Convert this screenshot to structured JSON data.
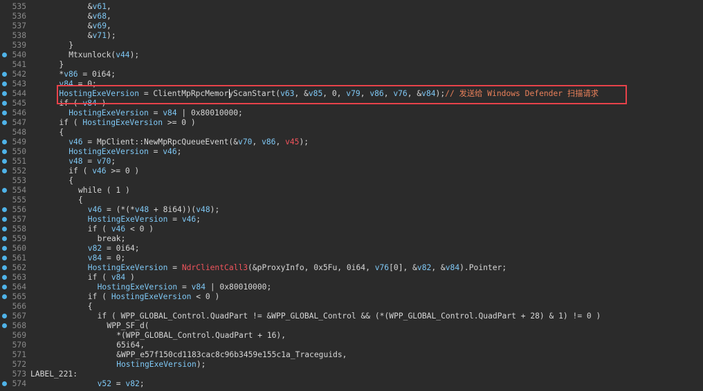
{
  "colors": {
    "background": "#2b2b2b",
    "default_text": "#d7d7d7",
    "variable": "#7fc8f5",
    "keyword_highlight": "#f0545c",
    "comment": "#e9805a",
    "breakpoint_dot": "#4fb3e8",
    "highlight_box": "#e8424a"
  },
  "lines": [
    {
      "n": "535",
      "bp": false,
      "indent": 6,
      "t": [
        [
          "w",
          "&"
        ],
        [
          "b",
          "v61"
        ],
        [
          "w",
          ","
        ]
      ]
    },
    {
      "n": "536",
      "bp": false,
      "indent": 6,
      "t": [
        [
          "w",
          "&"
        ],
        [
          "b",
          "v68"
        ],
        [
          "w",
          ","
        ]
      ]
    },
    {
      "n": "537",
      "bp": false,
      "indent": 6,
      "t": [
        [
          "w",
          "&"
        ],
        [
          "b",
          "v69"
        ],
        [
          "w",
          ","
        ]
      ]
    },
    {
      "n": "538",
      "bp": false,
      "indent": 6,
      "t": [
        [
          "w",
          "&"
        ],
        [
          "b",
          "v71"
        ],
        [
          "w",
          ");"
        ]
      ]
    },
    {
      "n": "539",
      "bp": false,
      "indent": 4,
      "t": [
        [
          "w",
          "}"
        ]
      ]
    },
    {
      "n": "540",
      "bp": true,
      "indent": 4,
      "t": [
        [
          "w",
          "Mtxunlock("
        ],
        [
          "b",
          "v44"
        ],
        [
          "w",
          ");"
        ]
      ]
    },
    {
      "n": "541",
      "bp": false,
      "indent": 3,
      "t": [
        [
          "w",
          "}"
        ]
      ]
    },
    {
      "n": "542",
      "bp": true,
      "indent": 3,
      "t": [
        [
          "w",
          "*"
        ],
        [
          "b",
          "v86"
        ],
        [
          "w",
          " = 0i64;"
        ]
      ]
    },
    {
      "n": "543",
      "bp": true,
      "indent": 3,
      "t": [
        [
          "b",
          "v84"
        ],
        [
          "w",
          " = 0;"
        ]
      ]
    },
    {
      "n": "544",
      "bp": true,
      "indent": 3,
      "t": [
        [
          "b",
          "HostingExeVersion"
        ],
        [
          "w",
          " = ClientMpRpcMemoryScanStart("
        ],
        [
          "b",
          "v63"
        ],
        [
          "w",
          ", &"
        ],
        [
          "b",
          "v85"
        ],
        [
          "w",
          ", 0, "
        ],
        [
          "b",
          "v79"
        ],
        [
          "w",
          ", "
        ],
        [
          "b",
          "v86"
        ],
        [
          "w",
          ", "
        ],
        [
          "b",
          "v76"
        ],
        [
          "w",
          ", &"
        ],
        [
          "b",
          "v84"
        ],
        [
          "w",
          ");"
        ],
        [
          "o",
          "// 发送给 Windows Defender 扫描请求"
        ]
      ]
    },
    {
      "n": "545",
      "bp": true,
      "indent": 3,
      "t": [
        [
          "w",
          "if ( "
        ],
        [
          "b",
          "v84"
        ],
        [
          "w",
          " )"
        ]
      ]
    },
    {
      "n": "546",
      "bp": true,
      "indent": 4,
      "t": [
        [
          "b",
          "HostingExeVersion"
        ],
        [
          "w",
          " = "
        ],
        [
          "b",
          "v84"
        ],
        [
          "w",
          " | 0x80010000;"
        ]
      ]
    },
    {
      "n": "547",
      "bp": true,
      "indent": 3,
      "t": [
        [
          "w",
          "if ( "
        ],
        [
          "b",
          "HostingExeVersion"
        ],
        [
          "w",
          " >= 0 )"
        ]
      ]
    },
    {
      "n": "548",
      "bp": false,
      "indent": 3,
      "t": [
        [
          "w",
          "{"
        ]
      ]
    },
    {
      "n": "549",
      "bp": true,
      "indent": 4,
      "t": [
        [
          "b",
          "v46"
        ],
        [
          "w",
          " = MpClient::NewMpRpcQueueEvent(&"
        ],
        [
          "b",
          "v70"
        ],
        [
          "w",
          ", "
        ],
        [
          "b",
          "v86"
        ],
        [
          "w",
          ", "
        ],
        [
          "r",
          "v45"
        ],
        [
          "w",
          ");"
        ]
      ]
    },
    {
      "n": "550",
      "bp": true,
      "indent": 4,
      "t": [
        [
          "b",
          "HostingExeVersion"
        ],
        [
          "w",
          " = "
        ],
        [
          "b",
          "v46"
        ],
        [
          "w",
          ";"
        ]
      ]
    },
    {
      "n": "551",
      "bp": true,
      "indent": 4,
      "t": [
        [
          "b",
          "v48"
        ],
        [
          "w",
          " = "
        ],
        [
          "b",
          "v70"
        ],
        [
          "w",
          ";"
        ]
      ]
    },
    {
      "n": "552",
      "bp": true,
      "indent": 4,
      "t": [
        [
          "w",
          "if ( "
        ],
        [
          "b",
          "v46"
        ],
        [
          "w",
          " >= 0 )"
        ]
      ]
    },
    {
      "n": "553",
      "bp": false,
      "indent": 4,
      "t": [
        [
          "w",
          "{"
        ]
      ]
    },
    {
      "n": "554",
      "bp": true,
      "indent": 5,
      "t": [
        [
          "w",
          "while ( 1 )"
        ]
      ]
    },
    {
      "n": "555",
      "bp": false,
      "indent": 5,
      "t": [
        [
          "w",
          "{"
        ]
      ]
    },
    {
      "n": "556",
      "bp": true,
      "indent": 6,
      "t": [
        [
          "b",
          "v46"
        ],
        [
          "w",
          " = (*(*"
        ],
        [
          "b",
          "v48"
        ],
        [
          "w",
          " + 8i64))("
        ],
        [
          "b",
          "v48"
        ],
        [
          "w",
          ");"
        ]
      ]
    },
    {
      "n": "557",
      "bp": true,
      "indent": 6,
      "t": [
        [
          "b",
          "HostingExeVersion"
        ],
        [
          "w",
          " = "
        ],
        [
          "b",
          "v46"
        ],
        [
          "w",
          ";"
        ]
      ]
    },
    {
      "n": "558",
      "bp": true,
      "indent": 6,
      "t": [
        [
          "w",
          "if ( "
        ],
        [
          "b",
          "v46"
        ],
        [
          "w",
          " < 0 )"
        ]
      ]
    },
    {
      "n": "559",
      "bp": true,
      "indent": 7,
      "t": [
        [
          "w",
          "break;"
        ]
      ]
    },
    {
      "n": "560",
      "bp": true,
      "indent": 6,
      "t": [
        [
          "b",
          "v82"
        ],
        [
          "w",
          " = 0i64;"
        ]
      ]
    },
    {
      "n": "561",
      "bp": true,
      "indent": 6,
      "t": [
        [
          "b",
          "v84"
        ],
        [
          "w",
          " = 0;"
        ]
      ]
    },
    {
      "n": "562",
      "bp": true,
      "indent": 6,
      "t": [
        [
          "b",
          "HostingExeVersion"
        ],
        [
          "w",
          " = "
        ],
        [
          "r",
          "NdrClientCall3"
        ],
        [
          "w",
          "(&pProxyInfo, 0x5Fu, 0i64, "
        ],
        [
          "b",
          "v76"
        ],
        [
          "w",
          "[0], &"
        ],
        [
          "b",
          "v82"
        ],
        [
          "w",
          ", &"
        ],
        [
          "b",
          "v84"
        ],
        [
          "w",
          ").Pointer;"
        ]
      ]
    },
    {
      "n": "563",
      "bp": true,
      "indent": 6,
      "t": [
        [
          "w",
          "if ( "
        ],
        [
          "b",
          "v84"
        ],
        [
          "w",
          " )"
        ]
      ]
    },
    {
      "n": "564",
      "bp": true,
      "indent": 7,
      "t": [
        [
          "b",
          "HostingExeVersion"
        ],
        [
          "w",
          " = "
        ],
        [
          "b",
          "v84"
        ],
        [
          "w",
          " | 0x80010000;"
        ]
      ]
    },
    {
      "n": "565",
      "bp": true,
      "indent": 6,
      "t": [
        [
          "w",
          "if ( "
        ],
        [
          "b",
          "HostingExeVersion"
        ],
        [
          "w",
          " < 0 )"
        ]
      ]
    },
    {
      "n": "566",
      "bp": false,
      "indent": 6,
      "t": [
        [
          "w",
          "{"
        ]
      ]
    },
    {
      "n": "567",
      "bp": true,
      "indent": 7,
      "t": [
        [
          "w",
          "if ( WPP_GLOBAL_Control.QuadPart != &WPP_GLOBAL_Control && (*(WPP_GLOBAL_Control.QuadPart + 28) & 1) != 0 )"
        ]
      ]
    },
    {
      "n": "568",
      "bp": true,
      "indent": 8,
      "t": [
        [
          "w",
          "WPP_SF_d("
        ]
      ]
    },
    {
      "n": "569",
      "bp": false,
      "indent": 9,
      "t": [
        [
          "w",
          "*(WPP_GLOBAL_Control.QuadPart + 16),"
        ]
      ]
    },
    {
      "n": "570",
      "bp": false,
      "indent": 9,
      "t": [
        [
          "w",
          "65i64,"
        ]
      ]
    },
    {
      "n": "571",
      "bp": false,
      "indent": 9,
      "t": [
        [
          "w",
          "&WPP_e57f150cd1183cac8c96b3459e155c1a_Traceguids,"
        ]
      ]
    },
    {
      "n": "572",
      "bp": false,
      "indent": 9,
      "t": [
        [
          "b",
          "HostingExeVersion"
        ],
        [
          "w",
          ");"
        ]
      ]
    },
    {
      "n": "573",
      "bp": false,
      "indent": 0,
      "t": [
        [
          "w",
          "LABEL_221:"
        ]
      ]
    },
    {
      "n": "574",
      "bp": true,
      "indent": 7,
      "t": [
        [
          "b",
          "v52"
        ],
        [
          "w",
          " = "
        ],
        [
          "b",
          "v82"
        ],
        [
          "w",
          ";"
        ]
      ]
    }
  ]
}
